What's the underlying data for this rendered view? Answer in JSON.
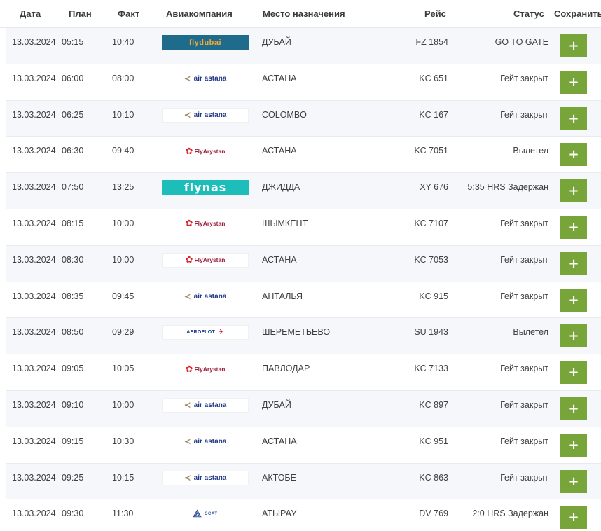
{
  "columns": {
    "date": "Дата",
    "plan": "План",
    "fact": "Факт",
    "airline": "Авиакомпания",
    "destination": "Место назначения",
    "flight": "Рейс",
    "status": "Статус",
    "save": "Сохранить"
  },
  "save_button_label": "+",
  "colors": {
    "save_button": "#77a53a",
    "row_alt": "#f5f7fa"
  },
  "flights": [
    {
      "date": "13.03.2024",
      "plan": "05:15",
      "fact": "10:40",
      "airline": {
        "name": "flydubai",
        "style": "fd",
        "icon": "flydubai-logo"
      },
      "destination": "ДУБАЙ",
      "flight": "FZ 1854",
      "status": "GO TO GATE"
    },
    {
      "date": "13.03.2024",
      "plan": "06:00",
      "fact": "08:00",
      "airline": {
        "name": "air astana",
        "style": "aa",
        "icon": "air-astana-logo"
      },
      "destination": "АСТАНА",
      "flight": "KC 651",
      "status": "Гейт закрыт"
    },
    {
      "date": "13.03.2024",
      "plan": "06:25",
      "fact": "10:10",
      "airline": {
        "name": "air astana",
        "style": "aa",
        "icon": "air-astana-logo"
      },
      "destination": "COLOMBO",
      "flight": "KC 167",
      "status": "Гейт закрыт"
    },
    {
      "date": "13.03.2024",
      "plan": "06:30",
      "fact": "09:40",
      "airline": {
        "name": "FlyArystan",
        "style": "fa",
        "icon": "flyarystan-logo"
      },
      "destination": "АСТАНА",
      "flight": "KC 7051",
      "status": "Вылетел"
    },
    {
      "date": "13.03.2024",
      "plan": "07:50",
      "fact": "13:25",
      "airline": {
        "name": "flynas",
        "style": "fn",
        "icon": "flynas-logo"
      },
      "destination": "ДЖИДДА",
      "flight": "XY 676",
      "status": "5:35 HRS Задержан"
    },
    {
      "date": "13.03.2024",
      "plan": "08:15",
      "fact": "10:00",
      "airline": {
        "name": "FlyArystan",
        "style": "fa",
        "icon": "flyarystan-logo"
      },
      "destination": "ШЫМКЕНТ",
      "flight": "KC 7107",
      "status": "Гейт закрыт"
    },
    {
      "date": "13.03.2024",
      "plan": "08:30",
      "fact": "10:00",
      "airline": {
        "name": "FlyArystan",
        "style": "fa",
        "icon": "flyarystan-logo"
      },
      "destination": "АСТАНА",
      "flight": "KC 7053",
      "status": "Гейт закрыт"
    },
    {
      "date": "13.03.2024",
      "plan": "08:35",
      "fact": "09:45",
      "airline": {
        "name": "air astana",
        "style": "aa",
        "icon": "air-astana-logo"
      },
      "destination": "АНТАЛЬЯ",
      "flight": "KC 915",
      "status": "Гейт закрыт"
    },
    {
      "date": "13.03.2024",
      "plan": "08:50",
      "fact": "09:29",
      "airline": {
        "name": "AEROFLOT",
        "style": "af",
        "icon": "aeroflot-logo"
      },
      "destination": "ШЕРЕМЕТЬЕВО",
      "flight": "SU 1943",
      "status": "Вылетел"
    },
    {
      "date": "13.03.2024",
      "plan": "09:05",
      "fact": "10:05",
      "airline": {
        "name": "FlyArystan",
        "style": "fa",
        "icon": "flyarystan-logo"
      },
      "destination": "ПАВЛОДАР",
      "flight": "KC 7133",
      "status": "Гейт закрыт"
    },
    {
      "date": "13.03.2024",
      "plan": "09:10",
      "fact": "10:00",
      "airline": {
        "name": "air astana",
        "style": "aa",
        "icon": "air-astana-logo"
      },
      "destination": "ДУБАЙ",
      "flight": "KC 897",
      "status": "Гейт закрыт"
    },
    {
      "date": "13.03.2024",
      "plan": "09:15",
      "fact": "10:30",
      "airline": {
        "name": "air astana",
        "style": "aa",
        "icon": "air-astana-logo"
      },
      "destination": "АСТАНА",
      "flight": "KC 951",
      "status": "Гейт закрыт"
    },
    {
      "date": "13.03.2024",
      "plan": "09:25",
      "fact": "10:15",
      "airline": {
        "name": "air astana",
        "style": "aa",
        "icon": "air-astana-logo"
      },
      "destination": "АКТОБЕ",
      "flight": "KC 863",
      "status": "Гейт закрыт"
    },
    {
      "date": "13.03.2024",
      "plan": "09:30",
      "fact": "11:30",
      "airline": {
        "name": "SCAT",
        "style": "sc",
        "icon": "scat-logo"
      },
      "destination": "АТЫРАУ",
      "flight": "DV 769",
      "status": "2:0 HRS Задержан"
    }
  ]
}
